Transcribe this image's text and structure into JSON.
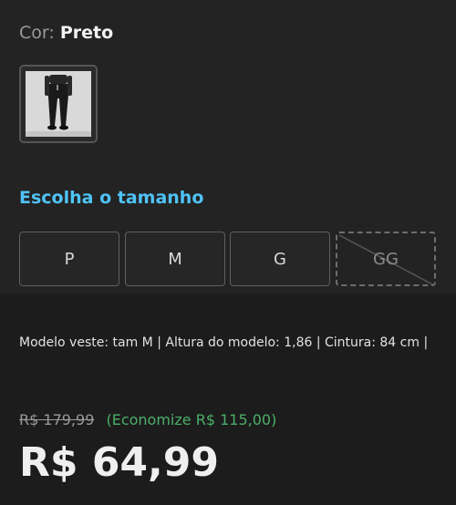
{
  "color": {
    "label": "Cor:",
    "value": "Preto"
  },
  "size_section": {
    "title": "Escolha o tamanho",
    "options": [
      {
        "label": "P",
        "available": true
      },
      {
        "label": "M",
        "available": true
      },
      {
        "label": "G",
        "available": true
      },
      {
        "label": "GG",
        "available": false
      }
    ]
  },
  "model_info": "Modelo veste: tam M | Altura do modelo: 1,86 | Cintura: 84 cm |",
  "price": {
    "old": "R$ 179,99",
    "savings": "(Economize R$ 115,00)",
    "current": "R$ 64,99"
  },
  "colors": {
    "accent": "#4fc3f7",
    "savings": "#4caf6a",
    "background": "#1c1c1c"
  }
}
